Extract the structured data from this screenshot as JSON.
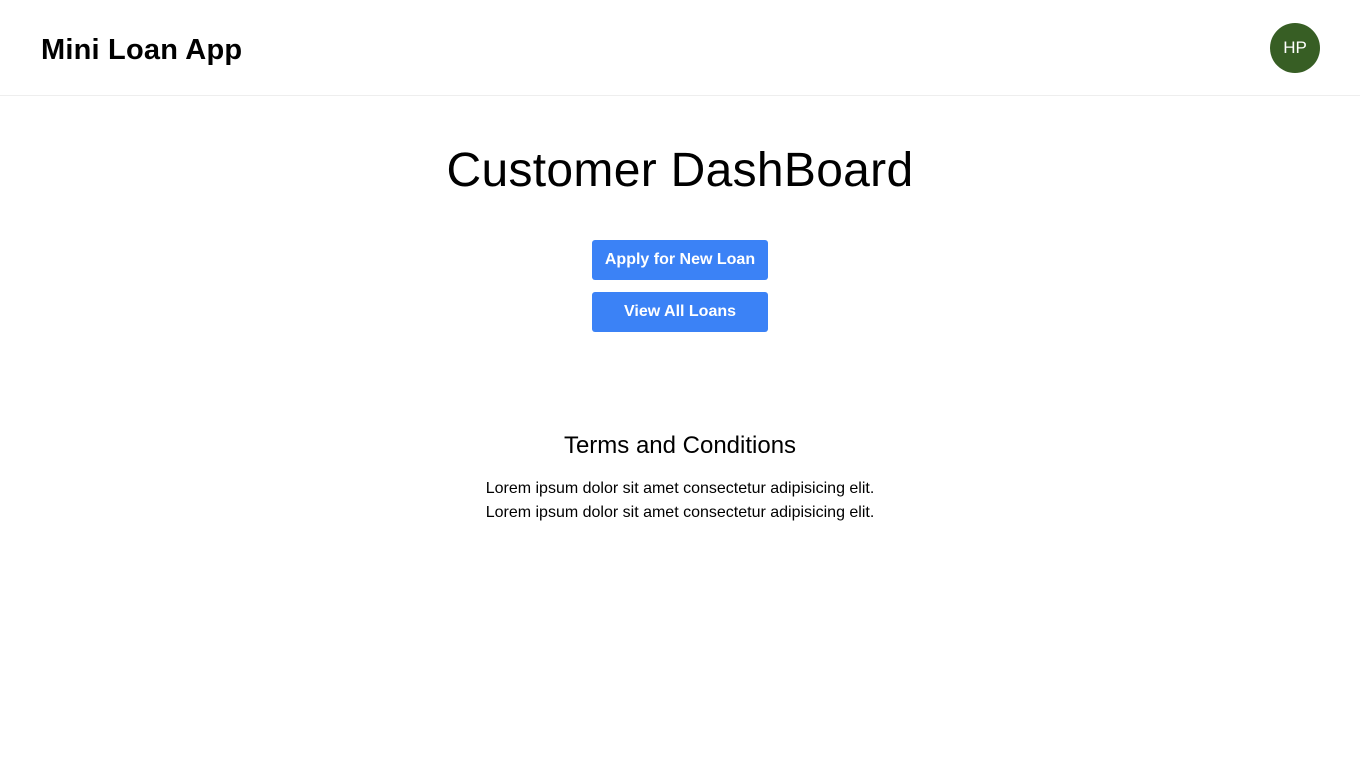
{
  "header": {
    "app_title": "Mini Loan App",
    "avatar": {
      "initials": "HP",
      "color": "#375e24"
    }
  },
  "main": {
    "page_title": "Customer DashBoard",
    "buttons": {
      "apply_label": "Apply for New Loan",
      "view_label": "View All Loans",
      "color": "#3b82f6"
    },
    "terms": {
      "title": "Terms and Conditions",
      "lines": [
        "Lorem ipsum dolor sit amet consectetur adipisicing elit.",
        "Lorem ipsum dolor sit amet consectetur adipisicing elit."
      ]
    }
  }
}
